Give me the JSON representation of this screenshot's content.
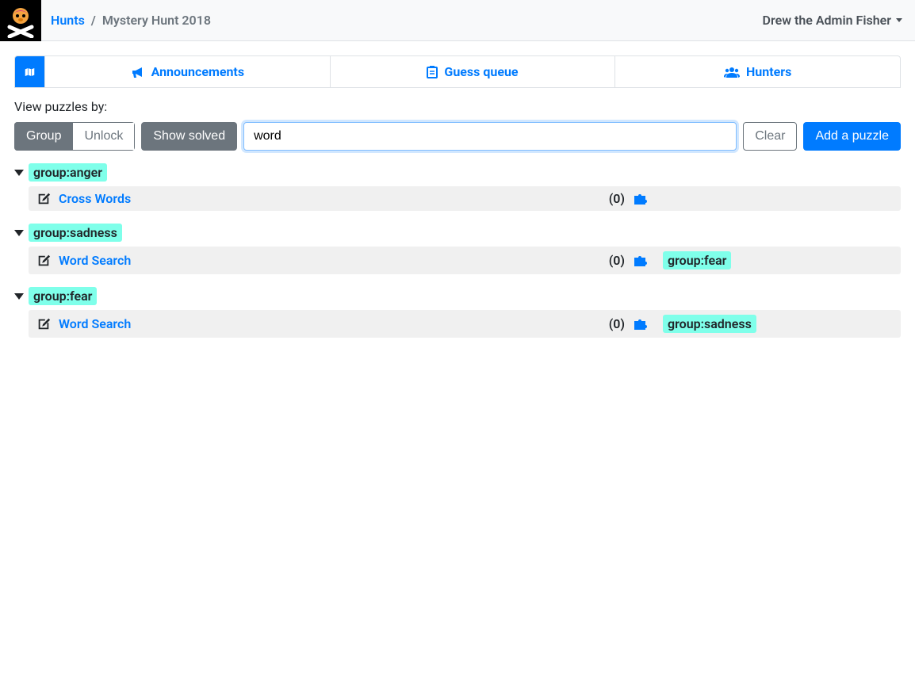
{
  "topbar": {
    "breadcrumb_root": "Hunts",
    "breadcrumb_current": "Mystery Hunt 2018",
    "user_name": "Drew the Admin Fisher"
  },
  "tabs": {
    "announcements": "Announcements",
    "guess_queue": "Guess queue",
    "hunters": "Hunters"
  },
  "controls": {
    "view_label": "View puzzles by:",
    "group_btn": "Group",
    "unlock_btn": "Unlock",
    "show_solved_btn": "Show solved",
    "search_value": "word",
    "clear_btn": "Clear",
    "add_puzzle_btn": "Add a puzzle"
  },
  "groups": [
    {
      "tag": "group:anger",
      "puzzles": [
        {
          "name": "Cross Words",
          "count": "(0)",
          "extra_tags": []
        }
      ]
    },
    {
      "tag": "group:sadness",
      "puzzles": [
        {
          "name": "Word Search",
          "count": "(0)",
          "extra_tags": [
            "group:fear"
          ]
        }
      ]
    },
    {
      "tag": "group:fear",
      "puzzles": [
        {
          "name": "Word Search",
          "count": "(0)",
          "extra_tags": [
            "group:sadness"
          ]
        }
      ]
    }
  ]
}
